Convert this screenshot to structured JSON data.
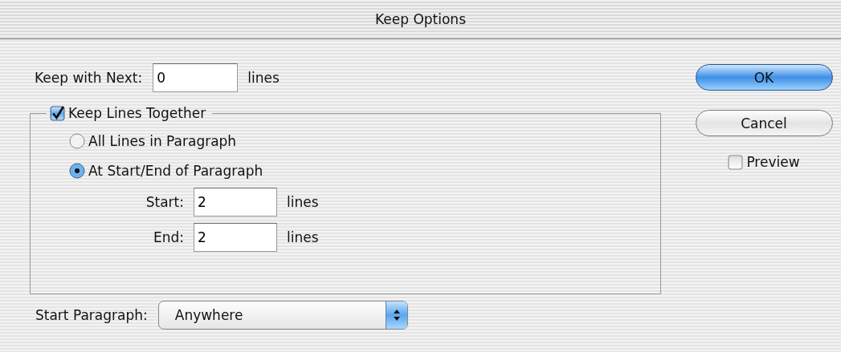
{
  "window": {
    "title": "Keep Options"
  },
  "keep_with_next": {
    "label": "Keep with Next:",
    "value": "0",
    "unit": "lines"
  },
  "keep_lines_together": {
    "label": "Keep Lines Together",
    "checked": true,
    "options": [
      {
        "label": "All Lines in Paragraph",
        "selected": false
      },
      {
        "label": "At Start/End of Paragraph",
        "selected": true
      }
    ],
    "fields": [
      {
        "label": "Start:",
        "value": "2",
        "unit": "lines"
      },
      {
        "label": "End:",
        "value": "2",
        "unit": "lines"
      }
    ]
  },
  "start_paragraph": {
    "label": "Start Paragraph:",
    "value": "Anywhere"
  },
  "buttons": [
    {
      "label": "OK",
      "default": true
    },
    {
      "label": "Cancel",
      "default": false
    }
  ],
  "preview": {
    "label": "Preview",
    "checked": false
  }
}
